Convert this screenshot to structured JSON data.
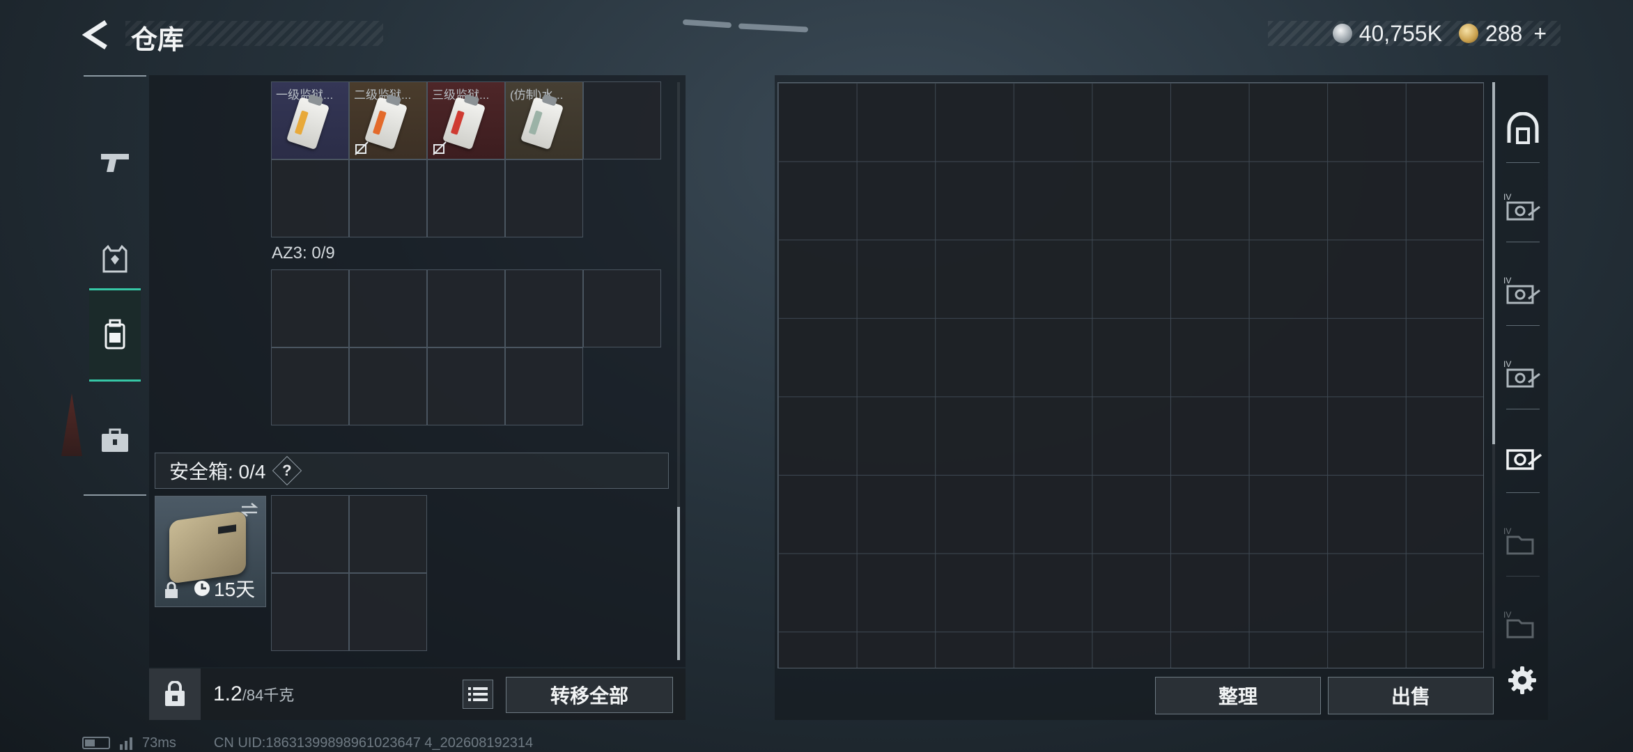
{
  "header": {
    "title": "仓库",
    "currencies": [
      {
        "icon": "silver-coin-icon",
        "value": "40,755K",
        "plus": ""
      },
      {
        "icon": "gold-coin-icon",
        "value": "288",
        "plus": "+"
      }
    ]
  },
  "rail": {
    "items": [
      {
        "icon": "pistol-icon",
        "active": false
      },
      {
        "icon": "armor-icon",
        "active": false
      },
      {
        "icon": "backpack-icon",
        "active": true
      },
      {
        "icon": "briefcase-icon",
        "active": false
      }
    ]
  },
  "storage": {
    "keycards": [
      {
        "label": "一级监狱...",
        "color": "#e8a93a",
        "no_trade": false
      },
      {
        "label": "二级监狱...",
        "color": "#e36a2b",
        "no_trade": true
      },
      {
        "label": "三级监狱...",
        "color": "#cf3b32",
        "no_trade": true
      },
      {
        "label": "(仿制)水...",
        "color": "#9bb2a6",
        "no_trade": false
      }
    ],
    "az3_label": "AZ3: 0/9",
    "safe_label": "安全箱:  0/4",
    "help_mark": "?",
    "safe_timer": "15天",
    "weight_main": "1.2",
    "weight_sub": "/84千克",
    "transfer_all": "转移全部"
  },
  "stash": {
    "sort_label": "整理",
    "sell_label": "出售",
    "tabs": [
      {
        "icon": "stash-main-icon"
      },
      {
        "icon": "stash-iv-case-icon"
      },
      {
        "icon": "stash-iv-case-icon"
      },
      {
        "icon": "stash-iv-case-icon"
      },
      {
        "icon": "stash-case-icon"
      },
      {
        "icon": "stash-iv-folder-icon"
      },
      {
        "icon": "stash-iv-folder-icon"
      }
    ]
  },
  "status": {
    "ping": "73ms",
    "uid": "CN UID:18631399898961023647 4_202608192314"
  }
}
